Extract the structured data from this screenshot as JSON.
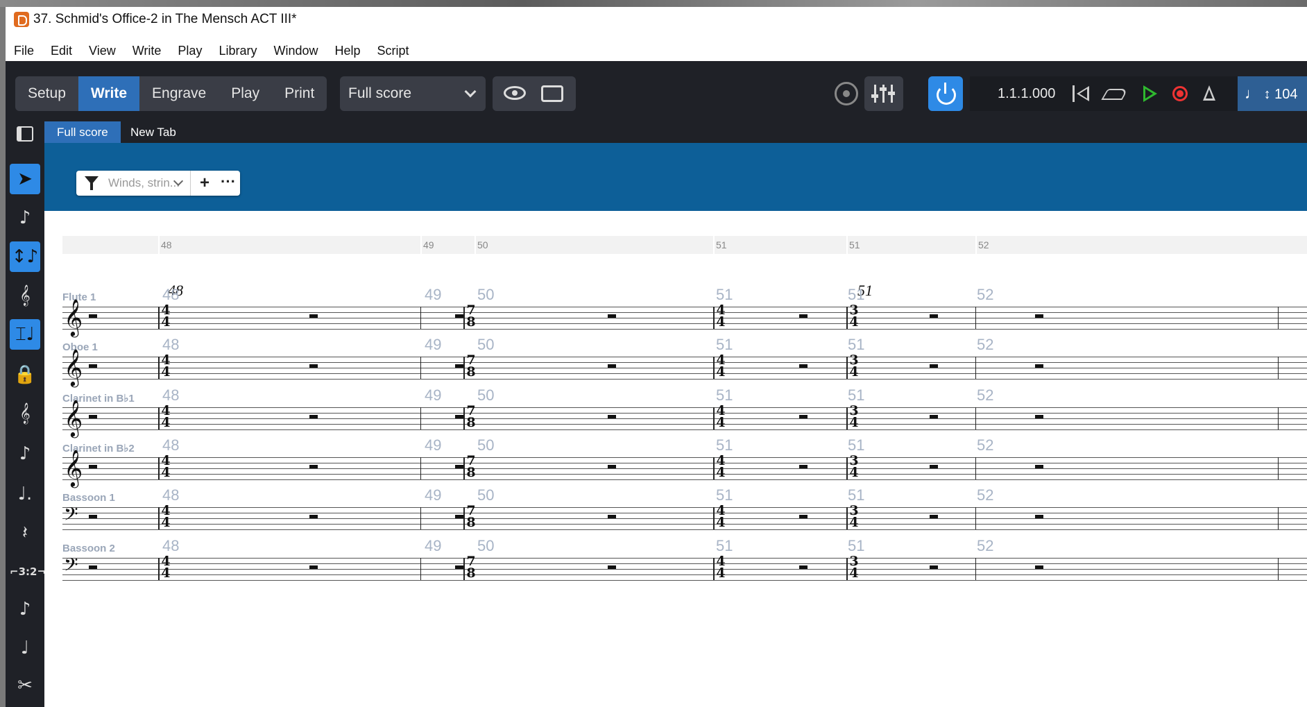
{
  "window": {
    "title": "37. Schmid's Office-2 in The Mensch ACT III*"
  },
  "menu": [
    "File",
    "Edit",
    "View",
    "Write",
    "Play",
    "Library",
    "Window",
    "Help",
    "Script"
  ],
  "toolbar": {
    "modes": [
      "Setup",
      "Write",
      "Engrave",
      "Play",
      "Print"
    ],
    "active_mode": "Write",
    "layout_select": "Full score",
    "timecode": "1.1.1.000",
    "tempo": "104",
    "tempo_note": "♩",
    "tempo_arrow": "↕",
    "colors": {
      "accent": "#2e6fb8",
      "power": "#2e8ae6",
      "play": "#2fb82f",
      "record": "#ee3333",
      "filter_band": "#0d5f98"
    }
  },
  "tabs": [
    "Full score",
    "New Tab"
  ],
  "active_tab": "Full score",
  "filter": {
    "text": "Winds, strin...",
    "add": "+",
    "more": "···"
  },
  "tools": [
    {
      "icon": "select-arrow-icon",
      "glyph": "➤",
      "on": true
    },
    {
      "icon": "note-input-icon",
      "glyph": "♪",
      "on": false
    },
    {
      "icon": "insert-mode-icon",
      "glyph": "↕♪",
      "on": true
    },
    {
      "icon": "chord-icon",
      "glyph": "𝄞",
      "on": false
    },
    {
      "icon": "force-duration-icon",
      "glyph": "⌶♩",
      "on": true
    },
    {
      "icon": "lock-duration-icon",
      "glyph": "🔒",
      "on": false
    },
    {
      "icon": "caret-icon",
      "glyph": "𝄞",
      "on": false
    },
    {
      "icon": "grace-note-icon",
      "glyph": "♪",
      "on": false
    },
    {
      "icon": "dotted-note-icon",
      "glyph": "♩.",
      "on": false
    },
    {
      "icon": "rest-icon",
      "glyph": "𝄽",
      "on": false
    },
    {
      "icon": "tuplet-icon",
      "label": "⌐3:2¬",
      "on": false
    },
    {
      "icon": "grace-slash-icon",
      "glyph": "♪",
      "on": false
    },
    {
      "icon": "tie-icon",
      "glyph": "♩",
      "on": false
    },
    {
      "icon": "scissors-icon",
      "glyph": "✂",
      "on": false
    }
  ],
  "ruler": [
    "48",
    "49",
    "50",
    "51",
    "51",
    "52"
  ],
  "rehearsal_marks": [
    "48",
    "51"
  ],
  "bar_numbers": [
    "48",
    "49",
    "50",
    "51",
    "51",
    "52"
  ],
  "time_signatures": [
    {
      "top": "4",
      "bottom": "4"
    },
    {
      "top": "7",
      "bottom": "8"
    },
    {
      "top": "4",
      "bottom": "4"
    },
    {
      "top": "3",
      "bottom": "4"
    }
  ],
  "instruments": [
    {
      "name": "Flute 1",
      "clef": "treble"
    },
    {
      "name": "Oboe 1",
      "clef": "treble"
    },
    {
      "name": "Clarinet in B♭1",
      "clef": "treble"
    },
    {
      "name": "Clarinet in B♭2",
      "clef": "treble"
    },
    {
      "name": "Bassoon 1",
      "clef": "bass"
    },
    {
      "name": "Bassoon 2",
      "clef": "bass"
    }
  ]
}
